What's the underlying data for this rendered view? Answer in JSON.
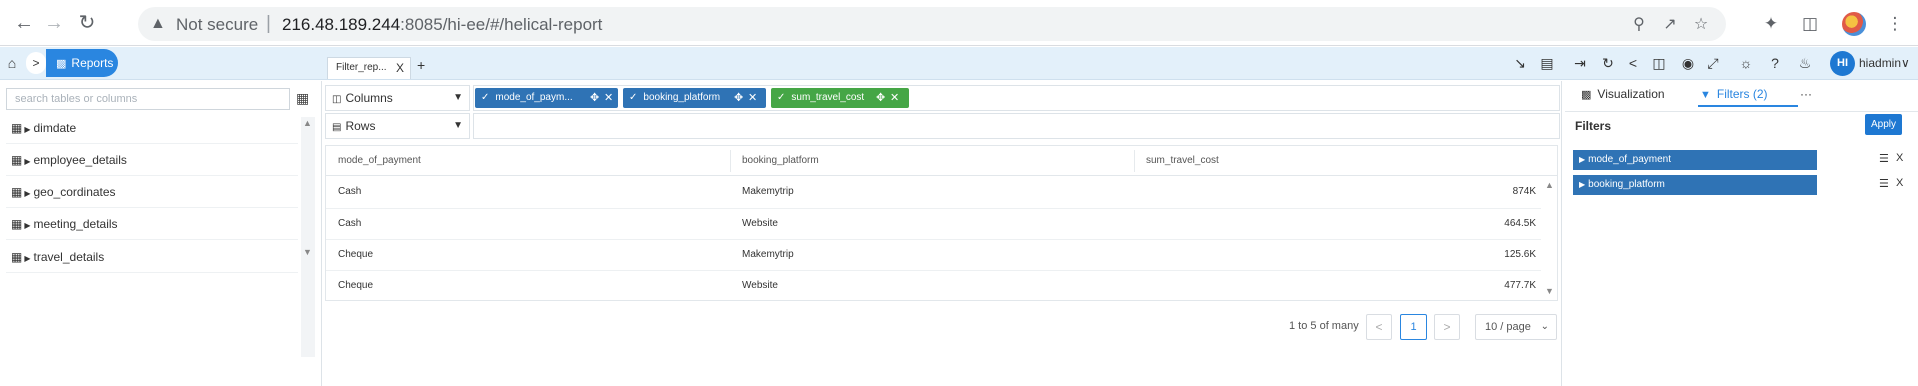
{
  "browser": {
    "back_icon": "back-arrow-icon",
    "forward_icon": "forward-arrow-icon",
    "reload_icon": "reload-icon",
    "security_label": "Not secure",
    "url_host": "216.48.189.244",
    "url_rest": ":8085/hi-ee/#/helical-report"
  },
  "app": {
    "breadcrumb_label": "Reports",
    "file_tab": "Filter_rep...",
    "file_tab_close": "X",
    "add_tab": "+",
    "user_initials": "HI",
    "user_name": "hiadmin∨"
  },
  "left": {
    "search_placeholder": "search tables or columns",
    "tables": [
      "dimdate",
      "employee_details",
      "geo_cordinates",
      "meeting_details",
      "travel_details"
    ]
  },
  "shelves": {
    "columns_label": "Columns",
    "rows_label": "Rows",
    "column_chips": [
      {
        "label": "mode_of_paym...",
        "color": "#2f73b5"
      },
      {
        "label": "booking_platform",
        "color": "#2f73b5"
      },
      {
        "label": "sum_travel_cost",
        "color": "#45a646"
      }
    ]
  },
  "table": {
    "headers": [
      "mode_of_payment",
      "booking_platform",
      "sum_travel_cost"
    ],
    "rows": [
      [
        "Cash",
        "Makemytrip",
        "874K"
      ],
      [
        "Cash",
        "Website",
        "464.5K"
      ],
      [
        "Cheque",
        "Makemytrip",
        "125.6K"
      ],
      [
        "Cheque",
        "Website",
        "477.7K"
      ]
    ]
  },
  "pager": {
    "summary": "1 to 5 of many",
    "prev": "<",
    "current": "1",
    "next": ">",
    "page_size": "10 / page"
  },
  "right": {
    "tab_visualization": "Visualization",
    "tab_filters": "Filters (2)",
    "more": "···",
    "heading": "Filters",
    "apply": "Apply",
    "filters": [
      "mode_of_payment",
      "booking_platform"
    ],
    "filter_close": "X"
  },
  "colors": {
    "accent": "#2a86e0",
    "chip_blue": "#2f73b5",
    "chip_green": "#45a646",
    "header_bg": "#e3f0fa"
  }
}
